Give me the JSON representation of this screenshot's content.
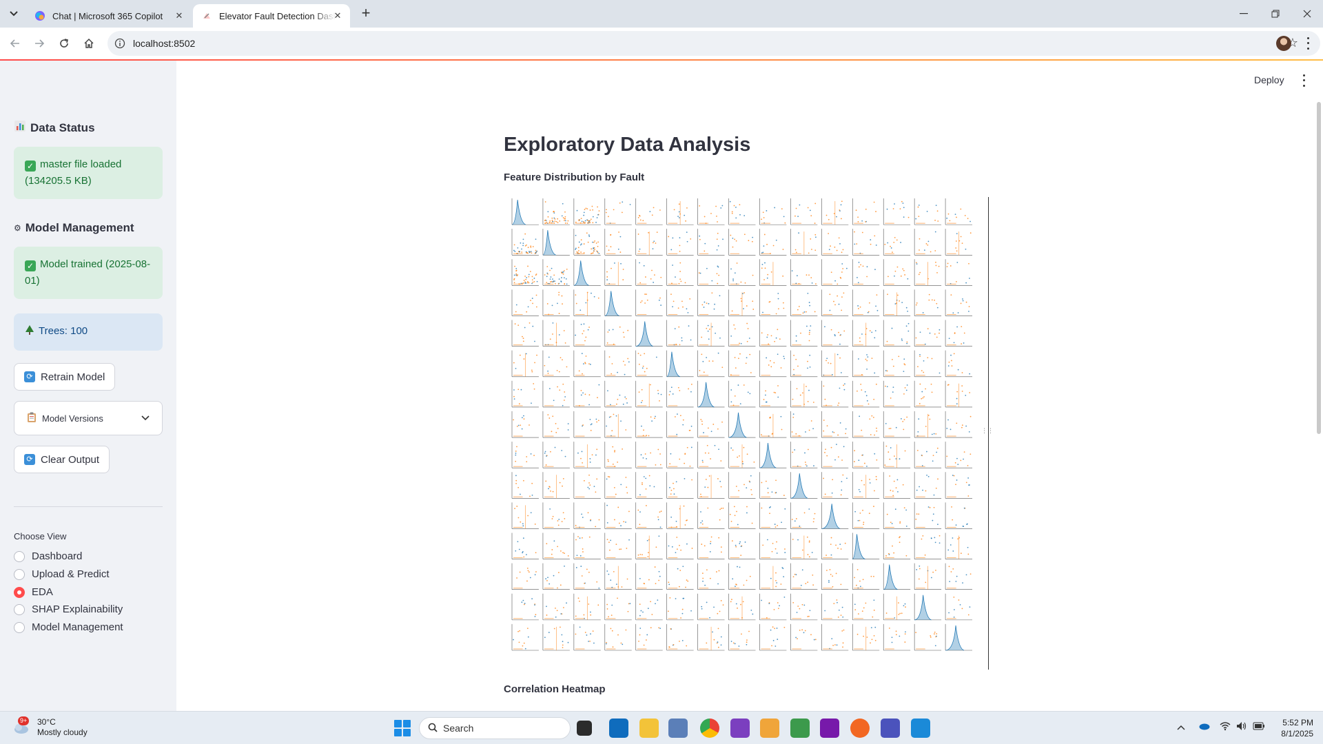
{
  "browser": {
    "tabs": [
      {
        "title": "Chat | Microsoft 365 Copilot",
        "active": false,
        "icon": "copilot-icon"
      },
      {
        "title": "Elevator Fault Detection Dashboard",
        "active": true,
        "icon": "streamlit-icon"
      }
    ],
    "url": "localhost:8502"
  },
  "sidebar": {
    "data_status_header": "Data Status",
    "data_status_icon": "bar-chart-icon",
    "data_status_message": "master file loaded (134205.5 KB)",
    "model_mgmt_header": "Model Management",
    "model_mgmt_icon": "gear-icon",
    "model_trained_message": "Model trained (2025-08-01)",
    "trees_message": "Trees: 100",
    "trees_icon": "tree-icon",
    "retrain_label": "Retrain Model",
    "model_versions_label": "Model Versions",
    "clear_output_label": "Clear Output",
    "choose_view_label": "Choose View",
    "views": [
      {
        "label": "Dashboard",
        "selected": false
      },
      {
        "label": "Upload & Predict",
        "selected": false
      },
      {
        "label": "EDA",
        "selected": true
      },
      {
        "label": "SHAP Explainability",
        "selected": false
      },
      {
        "label": "Model Management",
        "selected": false
      }
    ]
  },
  "main": {
    "deploy_label": "Deploy",
    "page_title": "Exploratory Data Analysis",
    "section1": "Feature Distribution by Fault",
    "section2": "Correlation Heatmap",
    "pairplot": {
      "rows": 15,
      "cols": 15,
      "series_colors": [
        "#1f77b4",
        "#ff7f0e"
      ]
    }
  },
  "taskbar": {
    "weather_temp": "30°C",
    "weather_desc": "Mostly cloudy",
    "weather_badge": "9+",
    "search_placeholder": "Search",
    "time": "5:52 PM",
    "date": "8/1/2025"
  },
  "colors": {
    "accent": "#ff4b4b",
    "success_bg": "#dcefe3",
    "info_bg": "#dbe7f4",
    "sidebar_bg": "#f0f2f6"
  }
}
